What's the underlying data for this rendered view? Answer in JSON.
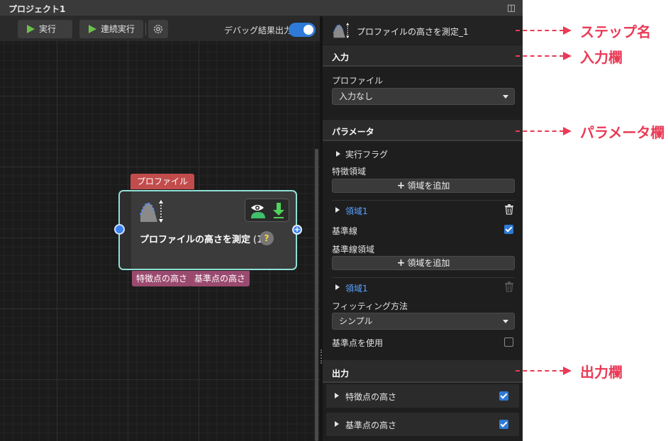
{
  "window": {
    "title": "プロジェクト1"
  },
  "toolbar": {
    "run_label": "実行",
    "continuous_run_label": "連続実行",
    "debug_label": "デバッグ結果出力",
    "debug_enabled": true
  },
  "node": {
    "input_tag": "プロファイル",
    "title": "プロファイルの高さを測定",
    "count": "(1)",
    "help": "?",
    "outputs": [
      "特徴点の高さ",
      "基準点の高さ"
    ]
  },
  "panel": {
    "step_name": "プロファイルの高さを測定_1",
    "input": {
      "heading": "入力",
      "profile_label": "プロファイル",
      "profile_value": "入力なし"
    },
    "parameters": {
      "heading": "パラメータ",
      "exec_flag": "実行フラグ",
      "feature_region_label": "特徴領域",
      "add_region_label": "領域を追加",
      "region1": "領域1",
      "baseline_label": "基準線",
      "baseline_checked": true,
      "baseline_region_label": "基準線領域",
      "add_region_label_2": "領域を追加",
      "region2": "領域1",
      "fitting_label": "フィッティング方法",
      "fitting_value": "シンプル",
      "use_ref_point_label": "基準点を使用",
      "use_ref_point_checked": false
    },
    "output": {
      "heading": "出力",
      "items": [
        {
          "label": "特徴点の高さ",
          "checked": true
        },
        {
          "label": "基準点の高さ",
          "checked": true
        }
      ]
    }
  },
  "annotations": {
    "step_name": "ステップ名",
    "input": "入力欄",
    "parameters": "パラメータ欄",
    "output": "出力欄"
  },
  "colors": {
    "accent": "#2e7ad6",
    "annotation": "#ea3a56",
    "node_border": "#8fe0d6",
    "input_tag": "#c24c4c",
    "output_tag": "#9b4a6f",
    "run_icon": "#6cc04a"
  }
}
